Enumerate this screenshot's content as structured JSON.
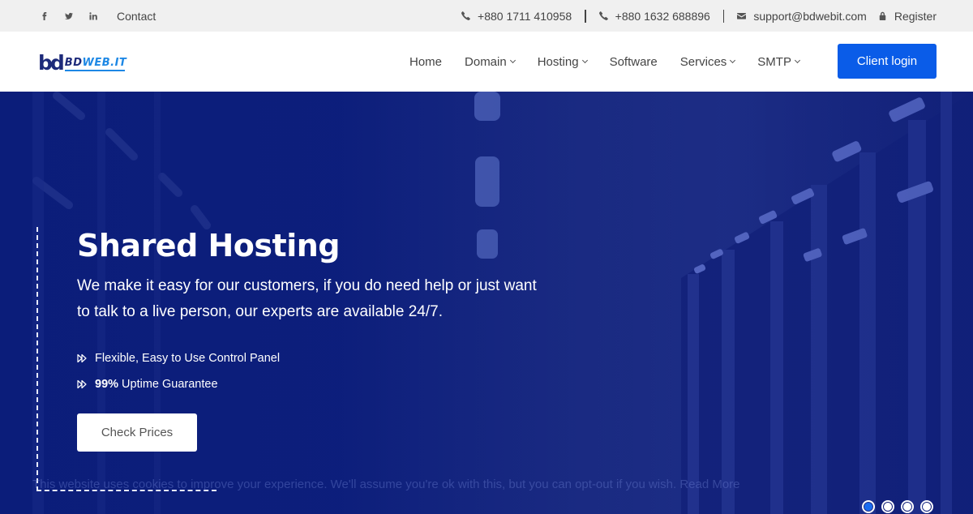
{
  "topbar": {
    "social": [
      {
        "name": "facebook",
        "glyph": "f"
      },
      {
        "name": "twitter",
        "glyph": "t"
      },
      {
        "name": "linkedin",
        "glyph": "in"
      }
    ],
    "contact_label": "Contact",
    "phone1": "+880 1711 410958",
    "phone2": "+880 1632 688896",
    "email": "support@bdwebit.com",
    "register_label": "Register"
  },
  "nav": {
    "logo": {
      "mark": "bd",
      "word_a": "BD",
      "word_b": "WEB.IT"
    },
    "items": [
      {
        "label": "Home",
        "dropdown": false
      },
      {
        "label": "Domain",
        "dropdown": true
      },
      {
        "label": "Hosting",
        "dropdown": true
      },
      {
        "label": "Software",
        "dropdown": false
      },
      {
        "label": "Services",
        "dropdown": true
      },
      {
        "label": "SMTP",
        "dropdown": true
      }
    ],
    "client_login_label": "Client login",
    "accent_color": "#0a5ce8"
  },
  "hero": {
    "title": "Shared Hosting",
    "description": "We make it easy for our customers, if you do need help or just want to talk to a live person, our experts are available 24/7.",
    "features": [
      {
        "bold": "",
        "text": "Flexible, Easy to Use Control Panel"
      },
      {
        "bold": "99%",
        "text": "Uptime Guarantee"
      }
    ],
    "cta_label": "Check Prices",
    "cookie_notice": "This website uses cookies to improve your experience. We'll assume you're ok with this, but you can opt-out if you wish. Read More",
    "slider": {
      "total": 4,
      "active_index": 0
    },
    "background_color": "#0d1f7c"
  }
}
